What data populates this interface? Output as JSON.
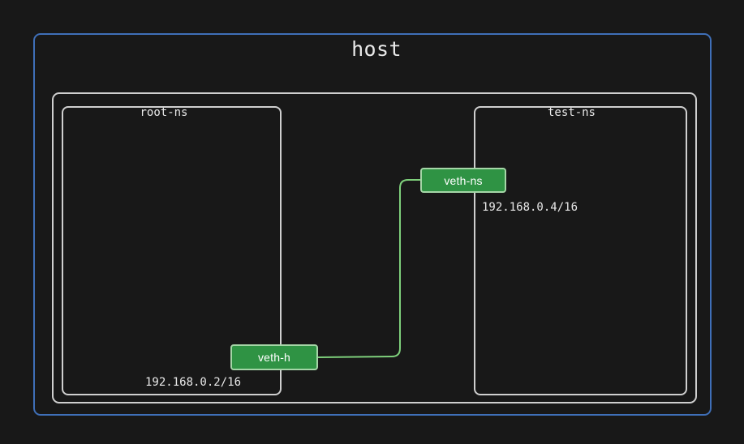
{
  "diagram": {
    "host": {
      "label": "host"
    },
    "namespaces": [
      {
        "label": "root-ns",
        "ip": "192.168.0.2/16",
        "interface": {
          "label": "veth-h"
        }
      },
      {
        "label": "test-ns",
        "ip": "192.168.0.4/16",
        "interface": {
          "label": "veth-ns"
        }
      }
    ],
    "colors": {
      "background": "#181818",
      "host_border": "#3f6fb8",
      "namespace_border": "#cfcfcf",
      "text": "#e9e9e9",
      "interface_fill": "#2f9344",
      "interface_border": "#a5d6a7",
      "link": "#7ecf7b"
    }
  }
}
